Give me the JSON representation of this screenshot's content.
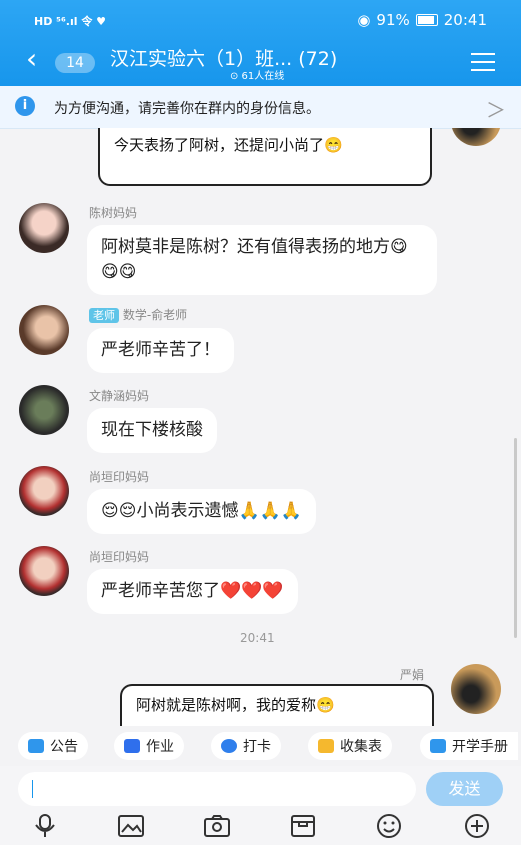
{
  "status": {
    "left": "HD ⁵⁶.ıl 令 ♥",
    "battery": "91%",
    "clock": "20:41"
  },
  "header": {
    "unread": "14",
    "title": "汉江实验六（1）班...  (72)",
    "online": "⊙ 61人在线"
  },
  "notice": {
    "info": "i",
    "text": "为方便沟通，请完善你在群内的身份信息。",
    "chevron": "＞"
  },
  "messages": [
    {
      "sticker": "今天表扬了阿树，还提问小尚了😁"
    },
    {
      "name": "陈树妈妈",
      "text": "阿树莫非是陈树？还有值得表扬的地方😋😋😋"
    },
    {
      "role": "老师",
      "name": "数学-俞老师",
      "text": "严老师辛苦了！"
    },
    {
      "name": "文静涵妈妈",
      "text": "现在下楼核酸"
    },
    {
      "name": "尚垣印妈妈",
      "text": "😌😌小尚表示遗憾🙏🙏🙏"
    },
    {
      "name": "尚垣印妈妈",
      "text": "严老师辛苦您了❤️❤️❤️"
    },
    {
      "time": "20:41"
    },
    {
      "name": "严娟",
      "sticker": "阿树就是陈树啊，我的爱称😁"
    }
  ],
  "quick_actions": [
    {
      "label": "公告",
      "color": "#2f96ec"
    },
    {
      "label": "作业",
      "color": "#2f6fec"
    },
    {
      "label": "打卡",
      "color": "#2f7fec"
    },
    {
      "label": "收集表",
      "color": "#f5b82e"
    },
    {
      "label": "开学手册",
      "color": "#2f96ec"
    }
  ],
  "input": {
    "send": "发送"
  },
  "toolbar_icons": [
    "microphone-icon",
    "image-icon",
    "camera-icon",
    "folder-icon",
    "emoji-icon",
    "plus-icon"
  ]
}
